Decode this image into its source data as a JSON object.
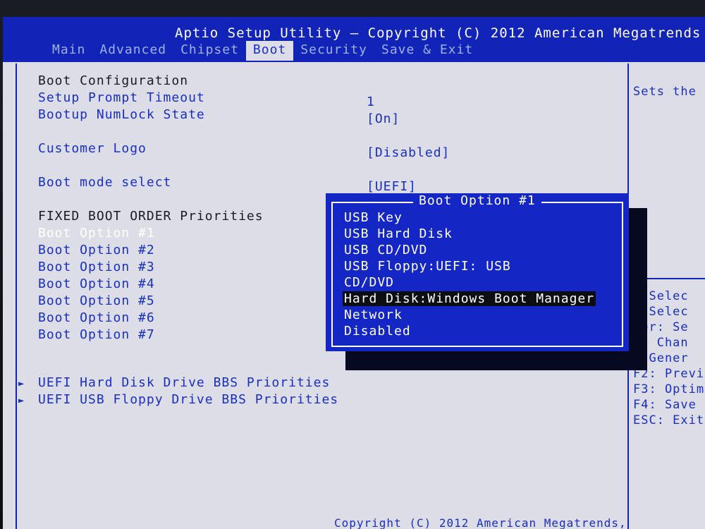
{
  "header": {
    "title": "Aptio Setup Utility – Copyright (C) 2012 American Megatrends",
    "tabs": [
      "Main",
      "Advanced",
      "Chipset",
      "Boot",
      "Security",
      "Save & Exit"
    ],
    "active_tab": "Boot"
  },
  "settings": {
    "boot_configuration": "Boot Configuration",
    "setup_prompt_timeout": {
      "label": "Setup Prompt Timeout",
      "value": "1"
    },
    "bootup_numlock": {
      "label": "Bootup NumLock State",
      "value": "[On]"
    },
    "customer_logo": {
      "label": "Customer Logo",
      "value": "[Disabled]"
    },
    "boot_mode": {
      "label": "Boot mode select",
      "value": "[UEFI]"
    },
    "fixed_boot_order": "FIXED BOOT ORDER Priorities",
    "boot_options": [
      "Boot Option #1",
      "Boot Option #2",
      "Boot Option #3",
      "Boot Option #4",
      "Boot Option #5",
      "Boot Option #6",
      "Boot Option #7"
    ],
    "submenus": [
      "UEFI Hard Disk Drive BBS Priorities",
      "UEFI USB Floppy Drive BBS Priorities"
    ]
  },
  "popup": {
    "title": "Boot Option #1",
    "options": [
      "USB Key",
      "USB Hard Disk",
      "USB CD/DVD",
      "USB Floppy:UEFI:  USB",
      "CD/DVD",
      "Hard Disk:Windows Boot Manager",
      "Network",
      "Disabled"
    ],
    "selected_index": 5
  },
  "side_panel": {
    "help_text": "Sets the",
    "keys": [
      ": Selec",
      ": Selec",
      "ter: Se",
      "-: Chan",
      ": Gener",
      "F2: Previ",
      "F3: Optim",
      "F4: Save",
      "ESC: Exit"
    ]
  },
  "footer": {
    "text": "Copyright (C) 2012 American Megatrends,"
  },
  "colors": {
    "bios_blue": "#1224b8",
    "screen_bg": "#dcdde6",
    "popup_blue": "#1427c4"
  }
}
